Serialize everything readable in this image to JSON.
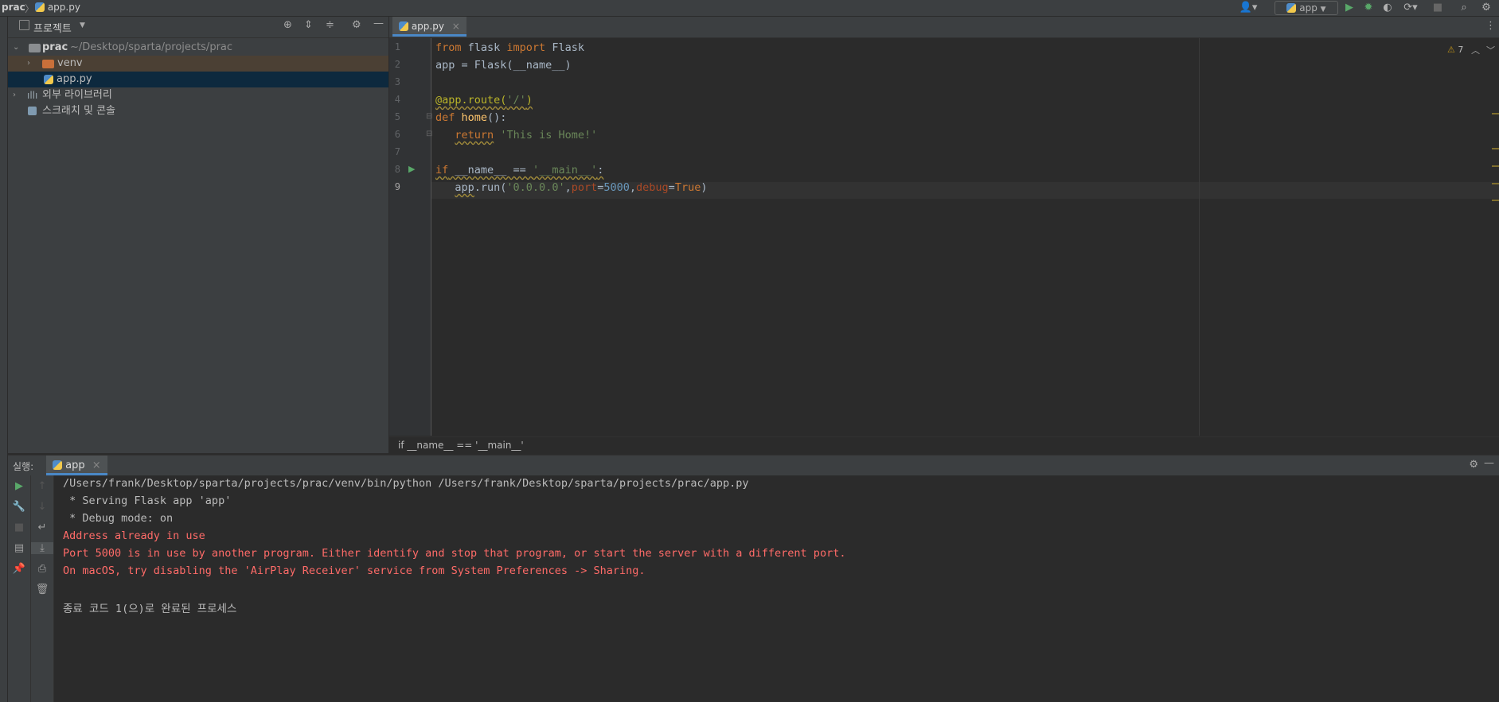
{
  "topbar": {
    "project": "prac",
    "separator": "〉",
    "file": "app.py",
    "run_config": "app"
  },
  "project_panel": {
    "title": "프로젝트",
    "tree": [
      {
        "label": "prac",
        "path": "~/Desktop/sparta/projects/prac"
      },
      {
        "label": "venv"
      },
      {
        "label": "app.py"
      },
      {
        "label": "외부 라이브러리"
      },
      {
        "label": "스크래치 및 콘솔"
      }
    ]
  },
  "editor": {
    "tab": "app.py",
    "warnings": "7",
    "line_numbers": [
      "1",
      "2",
      "3",
      "4",
      "5",
      "6",
      "7",
      "8",
      "9"
    ],
    "breadcrumb": "if __name__ == '__main__'"
  },
  "run_panel": {
    "label": "실행:",
    "tab": "app",
    "console": [
      "/Users/frank/Desktop/sparta/projects/prac/venv/bin/python /Users/frank/Desktop/sparta/projects/prac/app.py",
      " * Serving Flask app 'app'",
      " * Debug mode: on",
      "Address already in use",
      "Port 5000 is in use by another program. Either identify and stop that program, or start the server with a different port.",
      "On macOS, try disabling the 'AirPlay Receiver' service from System Preferences -> Sharing.",
      "종료 코드 1(으)로 완료된 프로세스"
    ]
  },
  "icons": {
    "run": "play-icon",
    "debug": "bug-icon",
    "settings": "gear-icon",
    "search": "search-icon"
  },
  "colors": {
    "accent": "#4a88c7",
    "run_green": "#59a869",
    "error_red": "#ff6b68"
  }
}
